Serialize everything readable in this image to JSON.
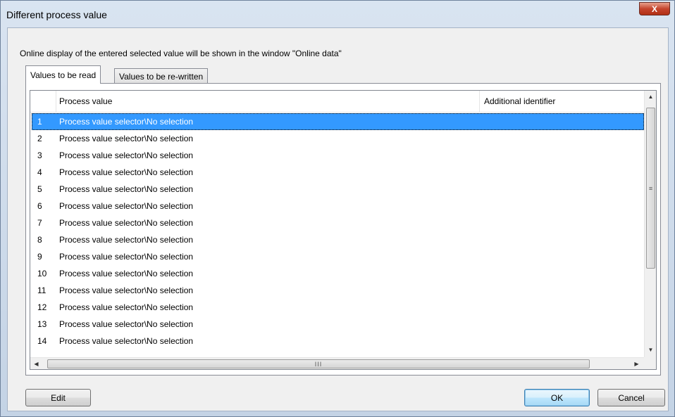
{
  "window": {
    "title": "Different process value",
    "close_label": "X"
  },
  "info_text": "Online display of the entered selected value will be shown in the window \"Online data\"",
  "tabs": [
    {
      "label": "Values to be read",
      "active": true
    },
    {
      "label": "Values to be re-written",
      "active": false
    }
  ],
  "table": {
    "columns": [
      "",
      "Process value",
      "Additional identifier"
    ],
    "selected_index": 0,
    "rows": [
      {
        "index": "1",
        "value": "Process value selector\\No selection",
        "identifier": ""
      },
      {
        "index": "2",
        "value": "Process value selector\\No selection",
        "identifier": ""
      },
      {
        "index": "3",
        "value": "Process value selector\\No selection",
        "identifier": ""
      },
      {
        "index": "4",
        "value": "Process value selector\\No selection",
        "identifier": ""
      },
      {
        "index": "5",
        "value": "Process value selector\\No selection",
        "identifier": ""
      },
      {
        "index": "6",
        "value": "Process value selector\\No selection",
        "identifier": ""
      },
      {
        "index": "7",
        "value": "Process value selector\\No selection",
        "identifier": ""
      },
      {
        "index": "8",
        "value": "Process value selector\\No selection",
        "identifier": ""
      },
      {
        "index": "9",
        "value": "Process value selector\\No selection",
        "identifier": ""
      },
      {
        "index": "10",
        "value": "Process value selector\\No selection",
        "identifier": ""
      },
      {
        "index": "11",
        "value": "Process value selector\\No selection",
        "identifier": ""
      },
      {
        "index": "12",
        "value": "Process value selector\\No selection",
        "identifier": ""
      },
      {
        "index": "13",
        "value": "Process value selector\\No selection",
        "identifier": ""
      },
      {
        "index": "14",
        "value": "Process value selector\\No selection",
        "identifier": ""
      }
    ]
  },
  "scrollbar_glyphs": {
    "up": "▲",
    "down": "▼",
    "left": "◀",
    "right": "▶",
    "v_grip": "≡",
    "h_grip": "III"
  },
  "buttons": {
    "edit": "Edit",
    "ok": "OK",
    "cancel": "Cancel"
  },
  "colors": {
    "selection": "#3399ff",
    "close_button": "#c5442d"
  }
}
